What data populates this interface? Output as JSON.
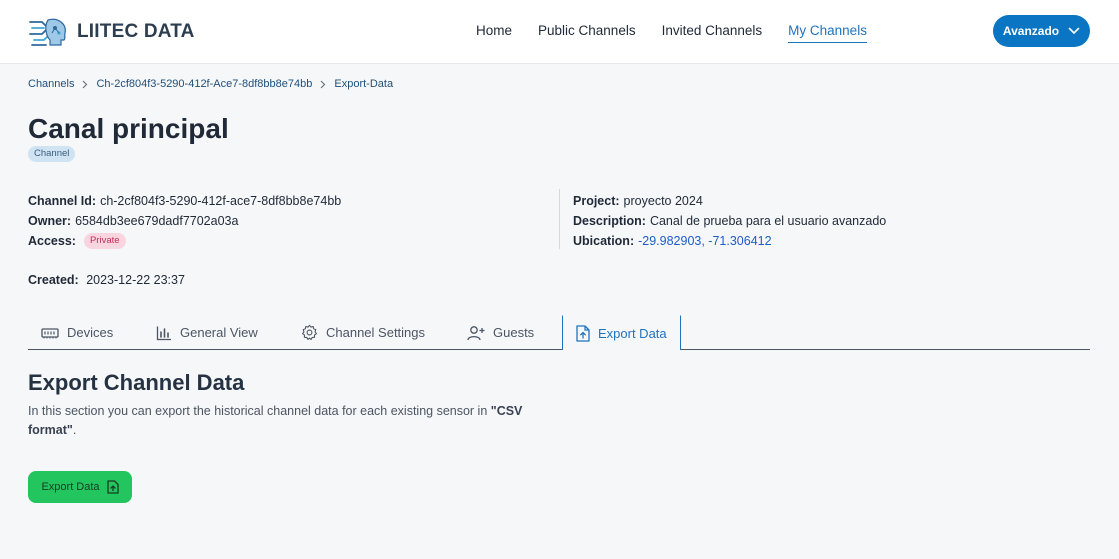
{
  "header": {
    "brand": "LIITEC DATA",
    "nav": [
      {
        "label": "Home"
      },
      {
        "label": "Public Channels"
      },
      {
        "label": "Invited Channels"
      },
      {
        "label": "My Channels",
        "active": true
      }
    ],
    "user_label": "Avanzado",
    "user_icon": "chevron-down-icon"
  },
  "breadcrumb": [
    "Channels",
    "Ch-2cf804f3-5290-412f-Ace7-8df8bb8e74bb",
    "Export-Data"
  ],
  "channel": {
    "title": "Canal principal",
    "type_badge": "Channel",
    "id_label": "Channel Id:",
    "id_value": "ch-2cf804f3-5290-412f-ace7-8df8bb8e74bb",
    "owner_label": "Owner:",
    "owner_value": "6584db3ee679dadf7702a03a",
    "access_label": "Access:",
    "access_value": "Private",
    "project_label": "Project:",
    "project_value": "proyecto 2024",
    "description_label": "Description:",
    "description_value": "Canal de prueba para el usuario avanzado",
    "ubication_label": "Ubication:",
    "ubication_value": "-29.982903, -71.306412",
    "created_label": "Created:",
    "created_value": "2023-12-22 23:37"
  },
  "tabs": [
    {
      "label": "Devices",
      "icon": "memory-icon"
    },
    {
      "label": "General View",
      "icon": "bar-chart-icon"
    },
    {
      "label": "Channel Settings",
      "icon": "gear-icon"
    },
    {
      "label": "Guests",
      "icon": "user-plus-icon"
    },
    {
      "label": "Export Data",
      "icon": "file-upload-icon",
      "active": true
    }
  ],
  "export": {
    "title": "Export Channel Data",
    "desc_prefix": "In this section you can export the historical channel data for each existing sensor in ",
    "desc_bold": "\"CSV format\"",
    "desc_suffix": ".",
    "button_label": "Export Data"
  },
  "colors": {
    "accent": "#1e73be",
    "user_button": "#0a75c2",
    "export_button": "#22c55e",
    "private_badge_bg": "#f9d5e0",
    "channel_badge_bg": "#cfe3f3"
  }
}
